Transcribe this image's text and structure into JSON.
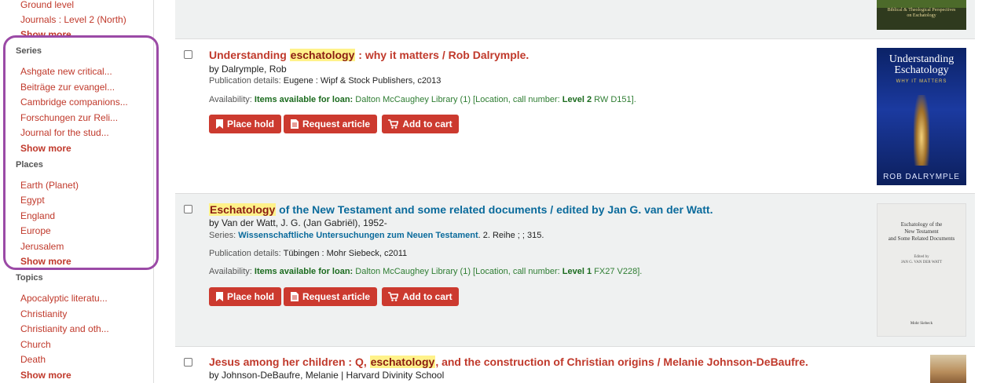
{
  "sidebar": {
    "top_items": [
      {
        "label": "Ground level"
      },
      {
        "label": "Journals : Level 2 (North)"
      },
      {
        "label": "Show more"
      }
    ],
    "series": {
      "heading": "Series",
      "items": [
        {
          "label": "Ashgate new critical..."
        },
        {
          "label": "Beiträge zur evangel..."
        },
        {
          "label": "Cambridge companions..."
        },
        {
          "label": "Forschungen zur Reli..."
        },
        {
          "label": "Journal for the stud..."
        }
      ],
      "more": "Show more"
    },
    "places": {
      "heading": "Places",
      "items": [
        {
          "label": "Earth (Planet)"
        },
        {
          "label": "Egypt"
        },
        {
          "label": "England"
        },
        {
          "label": "Europe"
        },
        {
          "label": "Jerusalem"
        }
      ],
      "more": "Show more"
    },
    "topics": {
      "heading": "Topics",
      "items": [
        {
          "label": "Apocalyptic literatu..."
        },
        {
          "label": "Christianity"
        },
        {
          "label": "Christianity and oth..."
        },
        {
          "label": "Church"
        },
        {
          "label": "Death"
        }
      ],
      "more": "Show more"
    }
  },
  "buttons": {
    "place_hold": "Place hold",
    "request_article": "Request article",
    "add_to_cart": "Add to cart"
  },
  "results": [
    {
      "title_pre": "Understanding ",
      "title_hl": "eschatology",
      "title_post": " : why it matters / Rob Dalrymple.",
      "author": "by Dalrymple, Rob",
      "pub_label": "Publication details: ",
      "pub_value": "Eugene : Wipf & Stock Publishers, c2013",
      "avail_label": "Availability: ",
      "avail_bold": "Items available for loan:",
      "avail_lib": " Dalton McCaughey Library (1) [Location, call number: ",
      "avail_level": "Level 2",
      "avail_call": " RW D151].",
      "cover": {
        "title": "Understanding Eschatology",
        "subtitle": "WHY IT MATTERS",
        "author": "ROB DALRYMPLE"
      }
    },
    {
      "title_hl": "Eschatology",
      "title_post": " of the New Testament and some related documents / edited by Jan G. van der Watt.",
      "author": "by Van der Watt, J. G. (Jan Gabriël), 1952-",
      "series_label": "Series: ",
      "series_value": "Wissenschaftliche Untersuchungen zum Neuen Testament",
      "series_tail": ". 2. Reihe ; ; 315.",
      "pub_label": "Publication details: ",
      "pub_value": "Tübingen : Mohr Siebeck, c2011",
      "avail_label": "Availability: ",
      "avail_bold": "Items available for loan:",
      "avail_lib": " Dalton McCaughey Library (1) [Location, call number: ",
      "avail_level": "Level 1",
      "avail_call": " FX27 V228].",
      "cover": {
        "line1": "Eschatology of the",
        "line2": "New Testament",
        "line3": "and Some Related Documents",
        "ed": "Edited by",
        "editor": "JAN G. VAN DER WATT",
        "publisher": "Mohr Siebeck"
      }
    },
    {
      "title_pre": "Jesus among her children : Q, ",
      "title_hl": "eschatology",
      "title_post": ", and the construction of Christian origins / Melanie Johnson-DeBaufre.",
      "author": "by Johnson-DeBaufre, Melanie |  Harvard Divinity School"
    }
  ],
  "top_cover": {
    "line1": "Biblical & Theological Perspectives",
    "line2": "on Eschatology"
  },
  "colors": {
    "accent": "#cc3a2f",
    "link": "#c0392b",
    "series_link": "#0b6b9c",
    "highlight": "#fff28a",
    "focus_ring": "#9b4aa6"
  }
}
